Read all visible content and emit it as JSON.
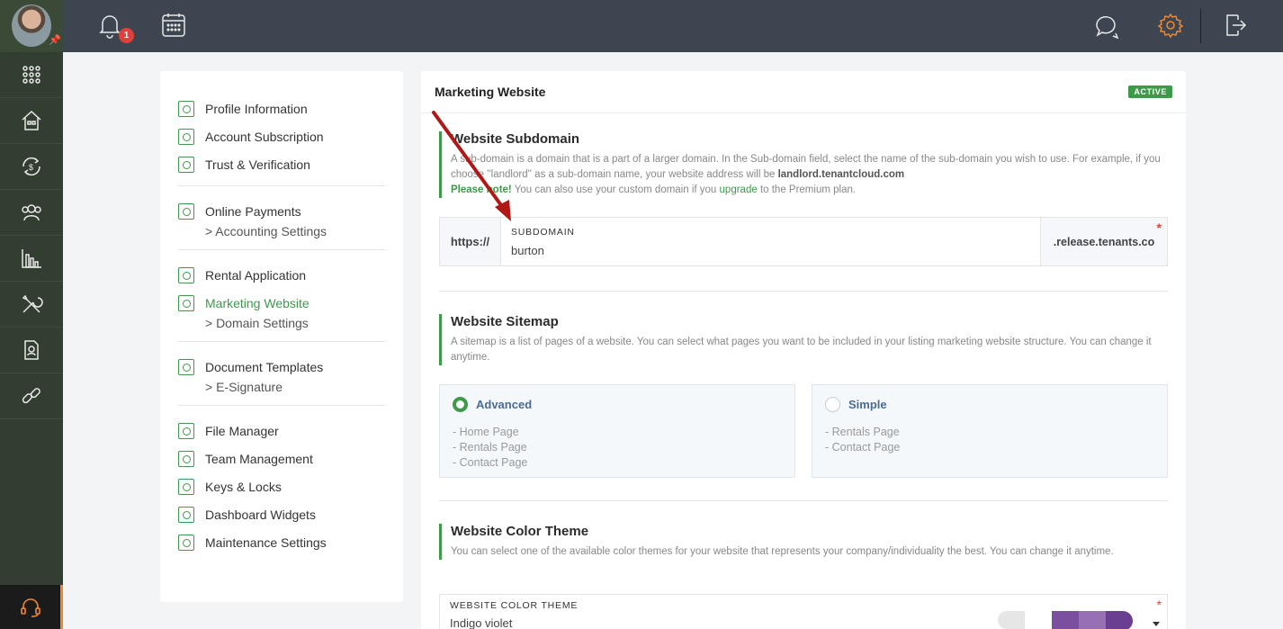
{
  "topbar": {
    "notifications_count": "1"
  },
  "settings_nav": {
    "groups": [
      {
        "items": [
          {
            "label": "Profile Information",
            "icon": "profile-icon"
          },
          {
            "label": "Account Subscription",
            "icon": "cupcake-icon"
          },
          {
            "label": "Trust & Verification",
            "icon": "verified-icon"
          }
        ]
      },
      {
        "items": [
          {
            "label": "Online Payments",
            "icon": "payment-icon",
            "sub": "> Accounting Settings"
          }
        ]
      },
      {
        "items": [
          {
            "label": "Rental Application",
            "icon": "application-icon"
          },
          {
            "label": "Marketing Website",
            "icon": "website-icon",
            "active": true,
            "sub": "> Domain Settings"
          }
        ]
      },
      {
        "items": [
          {
            "label": "Document Templates",
            "icon": "document-icon",
            "sub": "> E-Signature"
          }
        ]
      },
      {
        "items": [
          {
            "label": "File Manager",
            "icon": "file-icon"
          },
          {
            "label": "Team Management",
            "icon": "team-icon"
          },
          {
            "label": "Keys & Locks",
            "icon": "key-icon"
          },
          {
            "label": "Dashboard Widgets",
            "icon": "widgets-icon"
          },
          {
            "label": "Maintenance Settings",
            "icon": "maintenance-icon"
          }
        ]
      }
    ]
  },
  "main": {
    "title": "Marketing Website",
    "status": "ACTIVE",
    "subdomain_section": {
      "title": "Website Subdomain",
      "desc_1": "A sub-domain is a domain that is a part of a larger domain. In the Sub-domain field, select the name of the sub-domain you wish to use. For example, if you choose ''landlord'' as a sub-domain name, your website address will be ",
      "desc_domain": "landlord.tenantcloud.com",
      "note_label": "Please note!",
      "note_text_1": " You can also use your custom domain if you ",
      "note_link": "upgrade",
      "note_text_2": " to the Premium plan.",
      "prefix": "https://",
      "field_label": "SUBDOMAIN",
      "field_value": "burton",
      "suffix": ".release.tenants.co",
      "required_mark": "*"
    },
    "sitemap_section": {
      "title": "Website Sitemap",
      "desc": "A sitemap is a list of pages of a website. You can select what pages you want to be included in your listing marketing website structure. You can change it anytime.",
      "options": [
        {
          "label": "Advanced",
          "selected": true,
          "pages": [
            "- Home Page",
            "- Rentals Page",
            "- Contact Page"
          ]
        },
        {
          "label": "Simple",
          "selected": false,
          "pages": [
            "- Rentals Page",
            "- Contact Page"
          ]
        }
      ]
    },
    "theme_section": {
      "title": "Website Color Theme",
      "desc": "You can select one of the available color themes for your website that represents your company/individuality the best. You can change it anytime.",
      "field_label": "WEBSITE COLOR THEME",
      "field_value": "Indigo violet",
      "required_mark": "*",
      "swatch_colors": [
        "#7b4fa0",
        "#9570b4",
        "#6a3f92"
      ]
    }
  },
  "colors": {
    "accent": "#3d9a4a",
    "topbar": "#3d4650",
    "sidebar": "#323e30",
    "arrow": "#b01818"
  }
}
